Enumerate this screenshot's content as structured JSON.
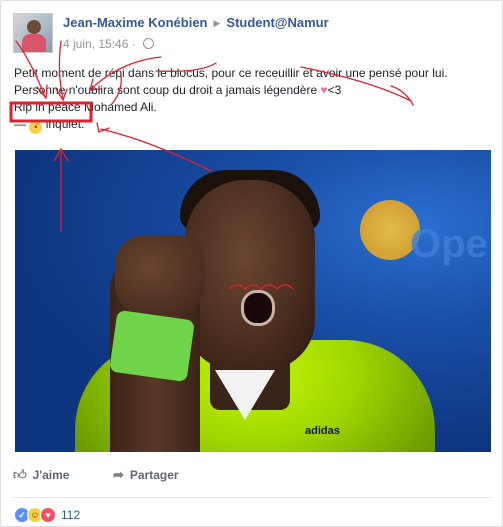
{
  "post": {
    "author": "Jean-Maxime Konébien",
    "group": "Student@Namur",
    "timestamp": "4 juin, 15:46",
    "line1": "Petit moment de répi dans le blocus, pour ce receuillir et avoir une pensé pour lui.",
    "line2": "Personne n'oublira sont coup du droit a jamais légendère",
    "line2_suffix": "<3",
    "line3_highlight": "Rip in peace",
    "line3_rest": " Mohamed Ali.",
    "feeling_dash": "—",
    "feeling": "inquiet."
  },
  "photo": {
    "bg_text": "Ope",
    "shirt_logo": "adidas"
  },
  "actions": {
    "like_label": "J'aime",
    "share_label": "Partager"
  },
  "reactions": {
    "count": "112"
  },
  "icons": {
    "privacy": "globe-icon",
    "like": "thumbs-up-icon",
    "share": "share-arrow-icon",
    "heart": "heart-emoji-icon",
    "feeling": "worried-face-icon"
  },
  "colors": {
    "link": "#365899",
    "annotation": "#e0202a",
    "jersey": "#9fd600"
  }
}
